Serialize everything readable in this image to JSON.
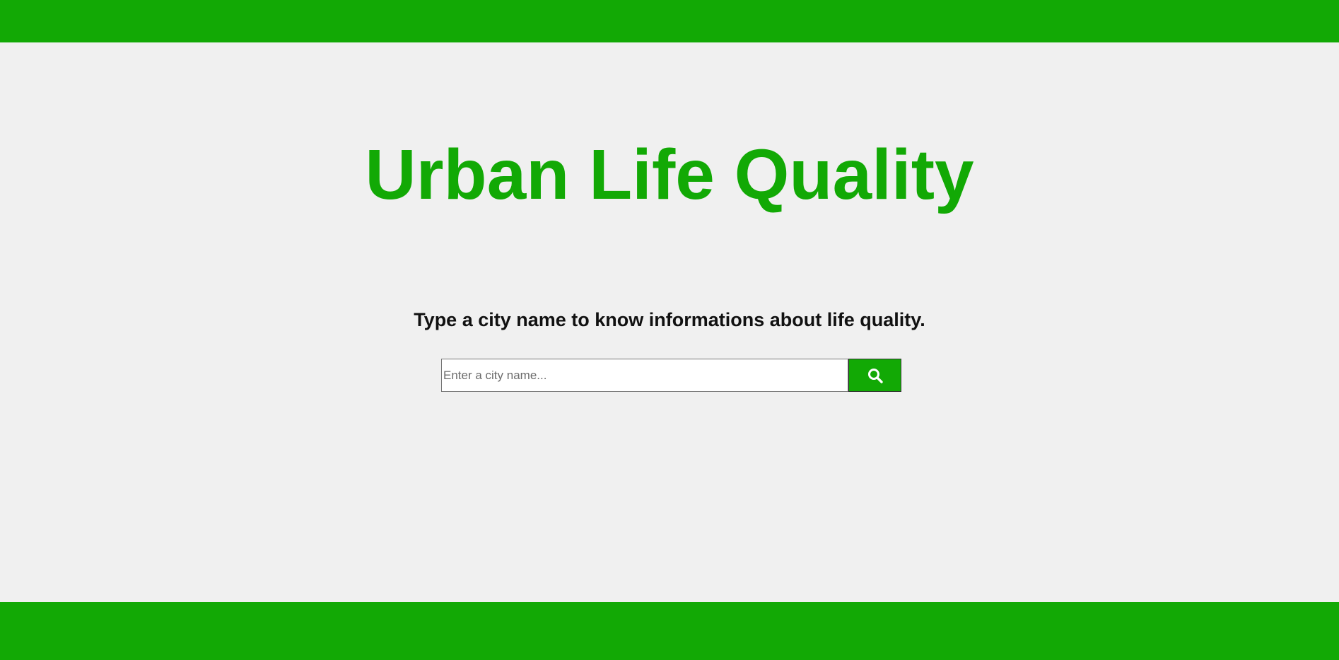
{
  "header": {
    "color": "#12a905"
  },
  "main": {
    "title": "Urban Life Quality",
    "subtitle": "Type a city name to know informations about life quality.",
    "search": {
      "placeholder": "Enter a city name...",
      "value": "",
      "button_icon": "search-icon"
    }
  },
  "footer": {
    "color": "#12a905"
  },
  "colors": {
    "accent": "#12a905",
    "background": "#f0f0f0",
    "text": "#111111"
  }
}
